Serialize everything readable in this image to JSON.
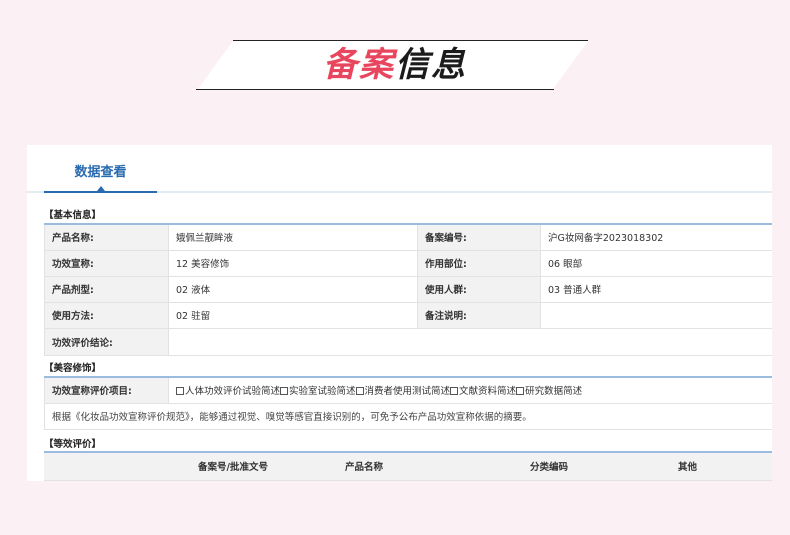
{
  "banner": {
    "title_red": "备案",
    "title_dark": "信息"
  },
  "tabs": {
    "active": "数据查看"
  },
  "basic": {
    "section": "【基本信息】",
    "rows": [
      {
        "l1": "产品名称:",
        "v1": "娥佩兰靓眸液",
        "l2": "备案编号:",
        "v2": "沪G妆网备字2023018302"
      },
      {
        "l1": "功效宣称:",
        "v1": "12 美容修饰",
        "l2": "作用部位:",
        "v2": "06 眼部"
      },
      {
        "l1": "产品剂型:",
        "v1": "02 液体",
        "l2": "使用人群:",
        "v2": "03 普通人群"
      },
      {
        "l1": "使用方法:",
        "v1": "02 驻留",
        "l2": "备注说明:",
        "v2": ""
      }
    ],
    "conclusion_label": "功效评价结论:",
    "conclusion_value": ""
  },
  "beauty": {
    "section": "【美容修饰】",
    "eval_label": "功效宣称评价项目:",
    "options": [
      "人体功效评价试验简述",
      "实验室试验简述",
      "消费者使用测试简述",
      "文献资料简述",
      "研究数据简述"
    ],
    "note": "根据《化妆品功效宣称评价规范》，能够通过视觉、嗅觉等感官直接识别的，可免予公布产品功效宣称依据的摘要。"
  },
  "equiv": {
    "section": "【等效评价】",
    "headers": [
      "",
      "备案号/批准文号",
      "产品名称",
      "分类编码",
      "其他"
    ]
  },
  "colors": {
    "accent": "#2a6bb0",
    "brand_red": "#e8465e",
    "background": "#fbf1f4"
  }
}
